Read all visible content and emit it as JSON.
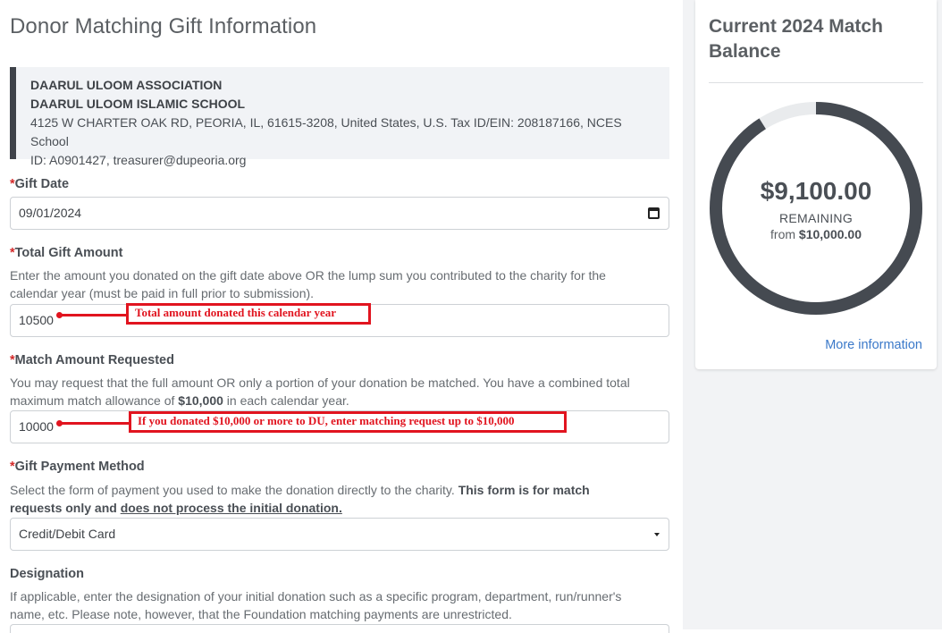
{
  "page": {
    "title": "Donor Matching Gift Information"
  },
  "charity": {
    "name1": "DAARUL ULOOM ASSOCIATION",
    "name2": "DAARUL ULOOM ISLAMIC SCHOOL",
    "address_line1": "4125 W CHARTER OAK RD, PEORIA, IL, 61615-3208, United States, U.S. Tax ID/EIN: 208187166, NCES School",
    "address_line2": "ID: A0901427, treasurer@dupeoria.org"
  },
  "form": {
    "required_marker": "*",
    "gift_date": {
      "label": "Gift Date",
      "value": "09/01/2024"
    },
    "total_gift": {
      "label": "Total Gift Amount",
      "help_line1": "Enter the amount you donated on the gift date above OR the lump sum you contributed to the charity for the",
      "help_line2": "calendar year (must be paid in full prior to submission).",
      "value": "10500"
    },
    "match_amount": {
      "label": "Match Amount Requested",
      "help_line1": "You may request that the full amount OR only a portion of your donation be matched. You have a combined total",
      "help_line2_pre": "maximum match allowance of ",
      "help_line2_bold": "$10,000",
      "help_line2_post": " in each calendar year.",
      "value": "10000"
    },
    "payment_method": {
      "label": "Gift Payment Method",
      "help_line1_pre": "Select the form of payment you used to make the donation directly to the charity. ",
      "help_line1_bold": "This form is for match",
      "help_line2_bold": "requests only and ",
      "help_line2_underline": "does not process the initial donation.",
      "selected": "Credit/Debit Card"
    },
    "designation": {
      "label": "Designation",
      "help_line1": "If applicable, enter the designation of your initial donation such as a specific program, department, run/runner's",
      "help_line2": "name, etc. Please note, however, that the Foundation matching payments are unrestricted."
    }
  },
  "annotations": {
    "total": "Total amount donated this calendar year",
    "match": "If you donated $10,000 or more to DU, enter matching request up to $10,000"
  },
  "balance_card": {
    "title": "Current 2024 Match Balance",
    "amount": "$9,100.00",
    "remaining_label": "REMAINING",
    "from_prefix": "from ",
    "from_amount": "$10,000.00",
    "remaining_fraction": 0.91,
    "ring_color": "#454a51",
    "ring_track_color": "#e9ebed",
    "more_info": "More information"
  },
  "icons": {
    "calendar": "calendar-icon",
    "dropdown": "chevron-down-icon"
  }
}
